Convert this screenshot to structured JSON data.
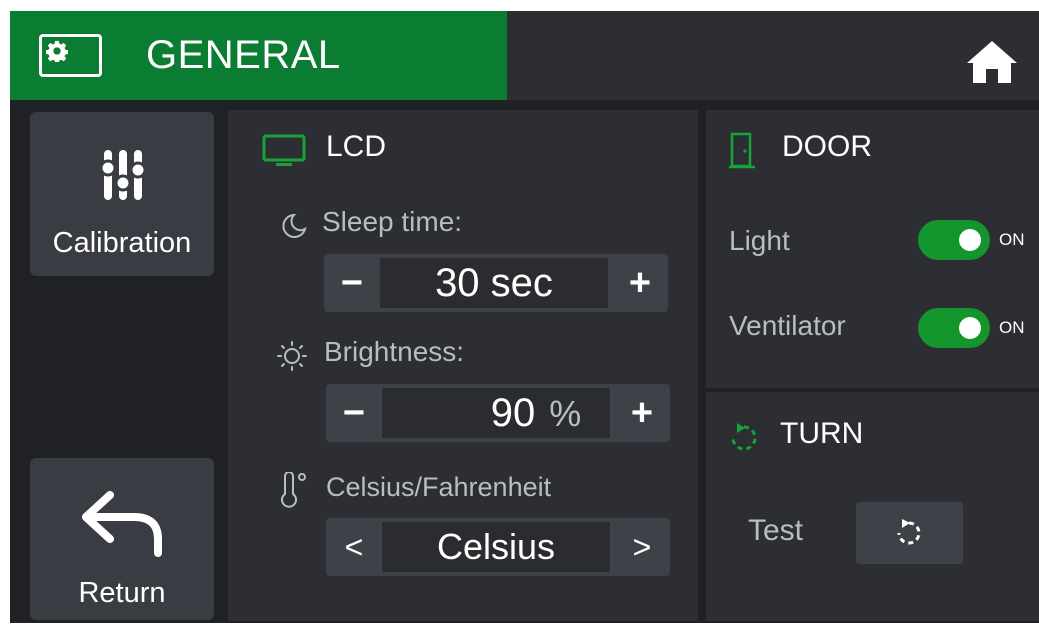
{
  "header": {
    "title": "GENERAL",
    "icon": "settings-card-icon",
    "home_icon": "home-icon",
    "accent_color": "#0a7d32"
  },
  "sidebar": {
    "calibration_label": "Calibration",
    "return_label": "Return"
  },
  "lcd": {
    "title": "LCD",
    "sleep_time": {
      "label": "Sleep time:",
      "value": "30 sec",
      "minus": "−",
      "plus": "+"
    },
    "brightness": {
      "label": "Brightness:",
      "value": "90",
      "unit": "%",
      "minus": "−",
      "plus": "+"
    },
    "temperature": {
      "label": "Celsius/Fahrenheit",
      "value": "Celsius",
      "prev": "<",
      "next": ">"
    }
  },
  "door": {
    "title": "DOOR",
    "light": {
      "label": "Light",
      "state": "ON"
    },
    "ventilator": {
      "label": "Ventilator",
      "state": "ON"
    },
    "toggle_color": "#13962b"
  },
  "turn": {
    "title": "TURN",
    "test_label": "Test"
  }
}
